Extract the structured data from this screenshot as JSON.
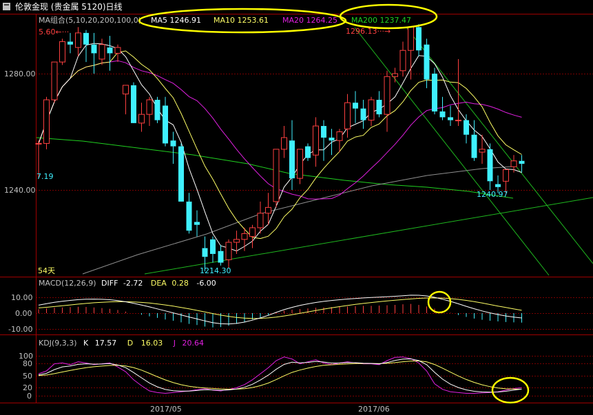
{
  "window": {
    "title": "伦敦金现 (贵金属 5120)日线",
    "period_label": "54天"
  },
  "colors": {
    "background": "#000000",
    "up_candle": "#ff4040",
    "down_candle": "#3ff0ff",
    "ma5": "#ffffff",
    "ma10": "#ffff66",
    "ma20": "#e020e0",
    "ma200": "#20d020",
    "ma100_gray": "#a0a0a0",
    "trendline": "#20c020",
    "annotation": "#ffff00",
    "grid": "#800000"
  },
  "price_panel": {
    "indicator_label": "MA组合(5,10,20,200,100,0)",
    "ma_values": [
      {
        "label": "MA5",
        "value": "1246.91",
        "color": "#ffffff"
      },
      {
        "label": "MA10",
        "value": "1253.61",
        "color": "#ffff66"
      },
      {
        "label": "MA20",
        "value": "1264.25",
        "color": "#e020e0"
      },
      {
        "label": "MA200",
        "value": "1237.47",
        "color": "#20d020"
      }
    ],
    "y_ticks": [
      "1280.00",
      "1240.00"
    ],
    "labels": {
      "high_left": "5.60",
      "high_mid": "1296.13",
      "low_left_edge": "7.19",
      "low_main": "1214.30",
      "low_recent": "1240.97"
    }
  },
  "macd_panel": {
    "label": "MACD(12,26,9)",
    "diff_label": "DIFF",
    "diff_value": "-2.72",
    "dea_label": "DEA",
    "dea_value": "0.28",
    "macd_value": "-6.00",
    "y_ticks": [
      "10.00",
      "0.00",
      "-10.00"
    ]
  },
  "kdj_panel": {
    "label": "KDJ(9,3,3)",
    "k_label": "K",
    "k_value": "17.57",
    "d_label": "D",
    "d_value": "16.03",
    "j_label": "J",
    "j_value": "20.64",
    "y_ticks": [
      "100",
      "80",
      "50",
      "20",
      "0"
    ]
  },
  "x_axis": {
    "labels": [
      "2017/05",
      "2017/06"
    ]
  },
  "chart_data": {
    "type": "candlestick",
    "candles": [
      [
        1256,
        1257,
        1244,
        1256
      ],
      [
        1256,
        1272,
        1254,
        1271
      ],
      [
        1271,
        1284,
        1270,
        1284
      ],
      [
        1284,
        1292,
        1283,
        1291
      ],
      [
        1291,
        1294,
        1287,
        1290
      ],
      [
        1289,
        1296,
        1286,
        1294
      ],
      [
        1294,
        1295,
        1284,
        1290
      ],
      [
        1290,
        1294,
        1280,
        1287
      ],
      [
        1285,
        1292,
        1283,
        1290
      ],
      [
        1289,
        1293,
        1281,
        1287
      ],
      [
        1287,
        1290,
        1284,
        1289
      ],
      [
        1273,
        1275,
        1266,
        1276
      ],
      [
        1276,
        1277,
        1263,
        1263
      ],
      [
        1263,
        1270,
        1260,
        1266
      ],
      [
        1266,
        1272,
        1262,
        1271
      ],
      [
        1271,
        1272,
        1263,
        1264
      ],
      [
        1269,
        1272,
        1255,
        1256
      ],
      [
        1257,
        1260,
        1249,
        1255
      ],
      [
        1255,
        1256,
        1236,
        1236
      ],
      [
        1236,
        1239,
        1225,
        1226
      ],
      [
        1229,
        1233,
        1224,
        1228
      ],
      [
        1220,
        1224,
        1212,
        1217
      ],
      [
        1223,
        1224,
        1215,
        1218
      ],
      [
        1219,
        1221,
        1214,
        1215
      ],
      [
        1216,
        1223,
        1213,
        1222
      ],
      [
        1222,
        1226,
        1218,
        1223
      ],
      [
        1223,
        1227,
        1219,
        1225
      ],
      [
        1224,
        1228,
        1220,
        1227
      ],
      [
        1227,
        1236,
        1225,
        1232
      ],
      [
        1232,
        1239,
        1228,
        1234
      ],
      [
        1236,
        1254,
        1234,
        1254
      ],
      [
        1254,
        1262,
        1251,
        1258
      ],
      [
        1257,
        1264,
        1240,
        1244
      ],
      [
        1244,
        1254,
        1242,
        1254
      ],
      [
        1255,
        1256,
        1250,
        1251
      ],
      [
        1252,
        1265,
        1248,
        1262
      ],
      [
        1262,
        1264,
        1250,
        1258
      ],
      [
        1258,
        1261,
        1252,
        1257
      ],
      [
        1257,
        1261,
        1253,
        1260
      ],
      [
        1261,
        1273,
        1258,
        1270
      ],
      [
        1270,
        1274,
        1263,
        1268
      ],
      [
        1268,
        1271,
        1261,
        1264
      ],
      [
        1264,
        1272,
        1262,
        1271
      ],
      [
        1271,
        1274,
        1265,
        1266
      ],
      [
        1266,
        1281,
        1260,
        1279
      ],
      [
        1279,
        1282,
        1277,
        1280
      ],
      [
        1281,
        1291,
        1279,
        1288
      ],
      [
        1288,
        1296,
        1278,
        1296
      ],
      [
        1296,
        1297,
        1286,
        1288
      ],
      [
        1290,
        1292,
        1275,
        1278
      ],
      [
        1280,
        1282,
        1266,
        1267
      ],
      [
        1267,
        1272,
        1264,
        1265
      ],
      [
        1265,
        1269,
        1262,
        1264
      ],
      [
        1264,
        1285,
        1262,
        1264
      ],
      [
        1264,
        1266,
        1256,
        1259
      ],
      [
        1259,
        1264,
        1250,
        1251
      ],
      [
        1253,
        1259,
        1249,
        1254
      ],
      [
        1254,
        1256,
        1240,
        1243
      ],
      [
        1242,
        1245,
        1239,
        1241
      ],
      [
        1243,
        1247,
        1239,
        1247
      ],
      [
        1248,
        1252,
        1246,
        1250
      ],
      [
        1250,
        1252,
        1246,
        1249
      ]
    ],
    "macd_hist": [
      2.5,
      3.0,
      3.4,
      3.6,
      3.8,
      4.0,
      3.9,
      3.6,
      3.2,
      2.7,
      2.0,
      1.0,
      0.0,
      -1.0,
      -2.0,
      -3.0,
      -4.0,
      -4.8,
      -5.8,
      -6.8,
      -7.5,
      -8.5,
      -9.0,
      -8.8,
      -8.0,
      -6.8,
      -5.5,
      -4.0,
      -2.6,
      -1.2,
      0.6,
      1.6,
      2.2,
      2.6,
      3.0,
      3.4,
      3.6,
      3.8,
      4.0,
      4.2,
      4.4,
      4.6,
      4.6,
      4.8,
      5.0,
      5.2,
      5.6,
      5.8,
      5.2,
      4.2,
      2.8,
      1.4,
      0.2,
      -1.2,
      -2.4,
      -3.4,
      -4.2,
      -4.8,
      -5.2,
      -5.6,
      -5.8,
      -6.0
    ],
    "kdj": {
      "K_last": 17.57,
      "D_last": 16.03,
      "J_last": 20.64,
      "J": [
        55,
        62,
        80,
        82,
        78,
        85,
        82,
        78,
        80,
        82,
        72,
        60,
        40,
        25,
        12,
        8,
        6,
        8,
        10,
        12,
        15,
        18,
        14,
        12,
        16,
        20,
        28,
        40,
        55,
        70,
        88,
        97,
        92,
        80,
        85,
        90,
        82,
        78,
        82,
        85,
        82,
        80,
        80,
        78,
        88,
        96,
        97,
        93,
        82,
        62,
        30,
        16,
        10,
        8,
        6,
        6,
        7,
        8,
        10,
        14,
        18,
        20.6
      ]
    },
    "y_price_range": [
      1205,
      1305
    ],
    "y_ticks_price": [
      1280,
      1240
    ],
    "y_ticks_macd": [
      10,
      0,
      -10
    ],
    "y_ticks_kdj": [
      100,
      80,
      50,
      20,
      0
    ]
  }
}
